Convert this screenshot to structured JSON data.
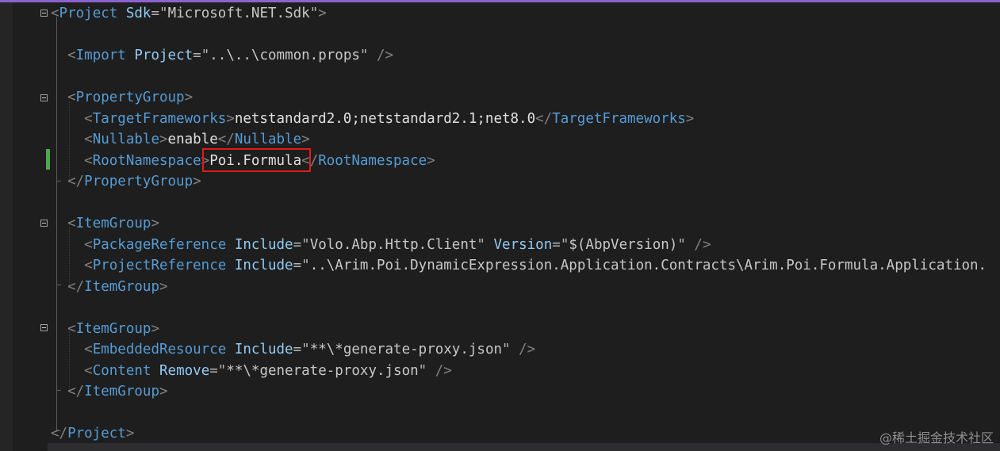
{
  "watermark": "@稀土掘金技术社区",
  "lines": [
    {
      "tokens": [
        {
          "c": "br",
          "t": "<"
        },
        {
          "c": "el",
          "t": "Project"
        },
        {
          "c": "tx",
          "t": " "
        },
        {
          "c": "at",
          "t": "Sdk"
        },
        {
          "c": "eq",
          "t": "="
        },
        {
          "c": "qu",
          "t": "\""
        },
        {
          "c": "vl",
          "t": "Microsoft.NET.Sdk"
        },
        {
          "c": "qu",
          "t": "\""
        },
        {
          "c": "br",
          "t": ">"
        }
      ]
    },
    {
      "tokens": []
    },
    {
      "tokens": [
        {
          "c": "tx",
          "t": "  "
        },
        {
          "c": "br",
          "t": "<"
        },
        {
          "c": "el",
          "t": "Import"
        },
        {
          "c": "tx",
          "t": " "
        },
        {
          "c": "at",
          "t": "Project"
        },
        {
          "c": "eq",
          "t": "="
        },
        {
          "c": "qu",
          "t": "\""
        },
        {
          "c": "vl",
          "t": "..\\..\\common.props"
        },
        {
          "c": "qu",
          "t": "\""
        },
        {
          "c": "tx",
          "t": " "
        },
        {
          "c": "br",
          "t": "/>"
        }
      ]
    },
    {
      "tokens": []
    },
    {
      "tokens": [
        {
          "c": "tx",
          "t": "  "
        },
        {
          "c": "br",
          "t": "<"
        },
        {
          "c": "el",
          "t": "PropertyGroup"
        },
        {
          "c": "br",
          "t": ">"
        }
      ]
    },
    {
      "tokens": [
        {
          "c": "tx",
          "t": "    "
        },
        {
          "c": "br",
          "t": "<"
        },
        {
          "c": "el",
          "t": "TargetFrameworks"
        },
        {
          "c": "br",
          "t": ">"
        },
        {
          "c": "tx",
          "t": "netstandard2.0;netstandard2.1;net8.0"
        },
        {
          "c": "br",
          "t": "</"
        },
        {
          "c": "el",
          "t": "TargetFrameworks"
        },
        {
          "c": "br",
          "t": ">"
        }
      ]
    },
    {
      "tokens": [
        {
          "c": "tx",
          "t": "    "
        },
        {
          "c": "br",
          "t": "<"
        },
        {
          "c": "el",
          "t": "Nullable"
        },
        {
          "c": "br",
          "t": ">"
        },
        {
          "c": "tx",
          "t": "enable"
        },
        {
          "c": "br",
          "t": "</"
        },
        {
          "c": "el",
          "t": "Nullable"
        },
        {
          "c": "br",
          "t": ">"
        }
      ]
    },
    {
      "tokens": [
        {
          "c": "tx",
          "t": "    "
        },
        {
          "c": "br",
          "t": "<"
        },
        {
          "c": "el",
          "t": "RootNamespace"
        },
        {
          "c": "br",
          "t": ">"
        },
        {
          "c": "tx",
          "t": "Poi.Formula"
        },
        {
          "c": "br",
          "t": "</"
        },
        {
          "c": "el",
          "t": "RootNamespace"
        },
        {
          "c": "br",
          "t": ">"
        }
      ]
    },
    {
      "tokens": [
        {
          "c": "tx",
          "t": "  "
        },
        {
          "c": "br",
          "t": "</"
        },
        {
          "c": "el",
          "t": "PropertyGroup"
        },
        {
          "c": "br",
          "t": ">"
        }
      ]
    },
    {
      "tokens": []
    },
    {
      "tokens": [
        {
          "c": "tx",
          "t": "  "
        },
        {
          "c": "br",
          "t": "<"
        },
        {
          "c": "el",
          "t": "ItemGroup"
        },
        {
          "c": "br",
          "t": ">"
        }
      ]
    },
    {
      "tokens": [
        {
          "c": "tx",
          "t": "    "
        },
        {
          "c": "br",
          "t": "<"
        },
        {
          "c": "el",
          "t": "PackageReference"
        },
        {
          "c": "tx",
          "t": " "
        },
        {
          "c": "at",
          "t": "Include"
        },
        {
          "c": "eq",
          "t": "="
        },
        {
          "c": "qu",
          "t": "\""
        },
        {
          "c": "vl",
          "t": "Volo.Abp.Http.Client"
        },
        {
          "c": "qu",
          "t": "\""
        },
        {
          "c": "tx",
          "t": " "
        },
        {
          "c": "at",
          "t": "Version"
        },
        {
          "c": "eq",
          "t": "="
        },
        {
          "c": "qu",
          "t": "\""
        },
        {
          "c": "vl",
          "t": "$(AbpVersion)"
        },
        {
          "c": "qu",
          "t": "\""
        },
        {
          "c": "tx",
          "t": " "
        },
        {
          "c": "br",
          "t": "/>"
        }
      ]
    },
    {
      "tokens": [
        {
          "c": "tx",
          "t": "    "
        },
        {
          "c": "br",
          "t": "<"
        },
        {
          "c": "el",
          "t": "ProjectReference"
        },
        {
          "c": "tx",
          "t": " "
        },
        {
          "c": "at",
          "t": "Include"
        },
        {
          "c": "eq",
          "t": "="
        },
        {
          "c": "qu",
          "t": "\""
        },
        {
          "c": "vl",
          "t": "..\\Arim.Poi.DynamicExpression.Application.Contracts\\Arim.Poi.Formula.Application."
        }
      ]
    },
    {
      "tokens": [
        {
          "c": "tx",
          "t": "  "
        },
        {
          "c": "br",
          "t": "</"
        },
        {
          "c": "el",
          "t": "ItemGroup"
        },
        {
          "c": "br",
          "t": ">"
        }
      ]
    },
    {
      "tokens": []
    },
    {
      "tokens": [
        {
          "c": "tx",
          "t": "  "
        },
        {
          "c": "br",
          "t": "<"
        },
        {
          "c": "el",
          "t": "ItemGroup"
        },
        {
          "c": "br",
          "t": ">"
        }
      ]
    },
    {
      "tokens": [
        {
          "c": "tx",
          "t": "    "
        },
        {
          "c": "br",
          "t": "<"
        },
        {
          "c": "el",
          "t": "EmbeddedResource"
        },
        {
          "c": "tx",
          "t": " "
        },
        {
          "c": "at",
          "t": "Include"
        },
        {
          "c": "eq",
          "t": "="
        },
        {
          "c": "qu",
          "t": "\""
        },
        {
          "c": "vl",
          "t": "**\\*generate-proxy.json"
        },
        {
          "c": "qu",
          "t": "\""
        },
        {
          "c": "tx",
          "t": " "
        },
        {
          "c": "br",
          "t": "/>"
        }
      ]
    },
    {
      "tokens": [
        {
          "c": "tx",
          "t": "    "
        },
        {
          "c": "br",
          "t": "<"
        },
        {
          "c": "el",
          "t": "Content"
        },
        {
          "c": "tx",
          "t": " "
        },
        {
          "c": "at",
          "t": "Remove"
        },
        {
          "c": "eq",
          "t": "="
        },
        {
          "c": "qu",
          "t": "\""
        },
        {
          "c": "vl",
          "t": "**\\*generate-proxy.json"
        },
        {
          "c": "qu",
          "t": "\""
        },
        {
          "c": "tx",
          "t": " "
        },
        {
          "c": "br",
          "t": "/>"
        }
      ]
    },
    {
      "tokens": [
        {
          "c": "tx",
          "t": "  "
        },
        {
          "c": "br",
          "t": "</"
        },
        {
          "c": "el",
          "t": "ItemGroup"
        },
        {
          "c": "br",
          "t": ">"
        }
      ]
    },
    {
      "tokens": []
    },
    {
      "tokens": [
        {
          "c": "br",
          "t": "</"
        },
        {
          "c": "el",
          "t": "Project"
        },
        {
          "c": "br",
          "t": ">"
        }
      ]
    }
  ]
}
